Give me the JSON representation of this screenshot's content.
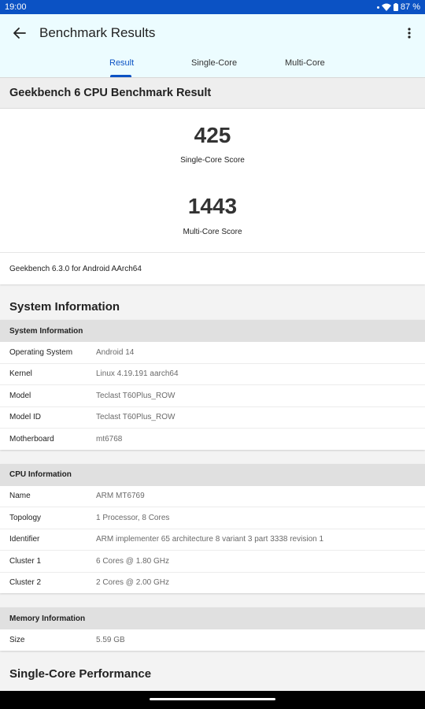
{
  "status": {
    "time": "19:00",
    "battery": "87 %"
  },
  "appbar": {
    "title": "Benchmark Results"
  },
  "tabs": [
    "Result",
    "Single-Core",
    "Multi-Core"
  ],
  "result": {
    "heading": "Geekbench 6 CPU Benchmark Result",
    "single_core_score": "425",
    "single_core_label": "Single-Core Score",
    "multi_core_score": "1443",
    "multi_core_label": "Multi-Core Score",
    "version": "Geekbench 6.3.0 for Android AArch64"
  },
  "system_info": {
    "heading": "System Information",
    "card_title": "System Information",
    "rows": [
      {
        "key": "Operating System",
        "value": "Android 14"
      },
      {
        "key": "Kernel",
        "value": "Linux 4.19.191 aarch64"
      },
      {
        "key": "Model",
        "value": "Teclast T60Plus_ROW"
      },
      {
        "key": "Model ID",
        "value": "Teclast T60Plus_ROW"
      },
      {
        "key": "Motherboard",
        "value": "mt6768"
      }
    ]
  },
  "cpu_info": {
    "card_title": "CPU Information",
    "rows": [
      {
        "key": "Name",
        "value": "ARM MT6769"
      },
      {
        "key": "Topology",
        "value": "1 Processor, 8 Cores"
      },
      {
        "key": "Identifier",
        "value": "ARM implementer 65 architecture 8 variant 3 part 3338 revision 1"
      },
      {
        "key": "Cluster 1",
        "value": "6 Cores @ 1.80 GHz"
      },
      {
        "key": "Cluster 2",
        "value": "2 Cores @ 2.00 GHz"
      }
    ]
  },
  "memory_info": {
    "card_title": "Memory Information",
    "rows": [
      {
        "key": "Size",
        "value": "5.59 GB"
      }
    ]
  },
  "single_core_perf": {
    "heading": "Single-Core Performance"
  }
}
